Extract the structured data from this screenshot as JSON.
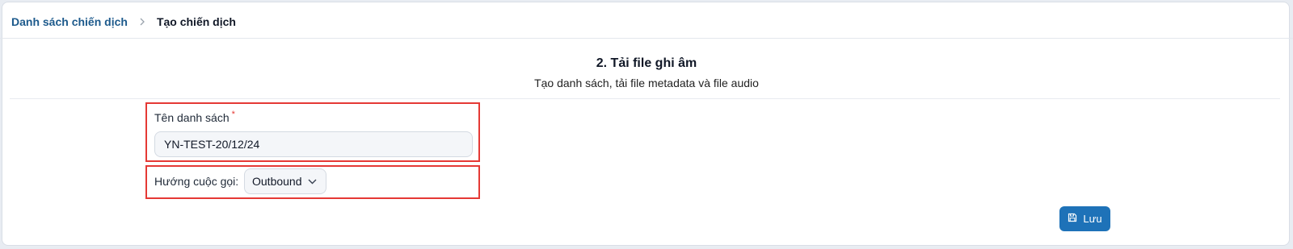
{
  "breadcrumb": {
    "parent": "Danh sách chiến dịch",
    "current": "Tạo chiến dịch"
  },
  "step": {
    "title": "2. Tải file ghi âm",
    "subtitle": "Tạo danh sách, tải file metadata và file audio"
  },
  "form": {
    "name_label": "Tên danh sách",
    "name_required_mark": "*",
    "name_value": "YN-TEST-20/12/24",
    "direction_label": "Hướng cuộc gọi:",
    "direction_value": "Outbound"
  },
  "actions": {
    "save_label": "Lưu"
  },
  "icons": {
    "separator": "chevron-right-icon",
    "select_caret": "chevron-down-icon",
    "save": "floppy-disk-icon"
  },
  "colors": {
    "link": "#1d5a8c",
    "primary_button": "#1e72b8",
    "highlight_border": "#e53935",
    "required": "#e53935"
  }
}
